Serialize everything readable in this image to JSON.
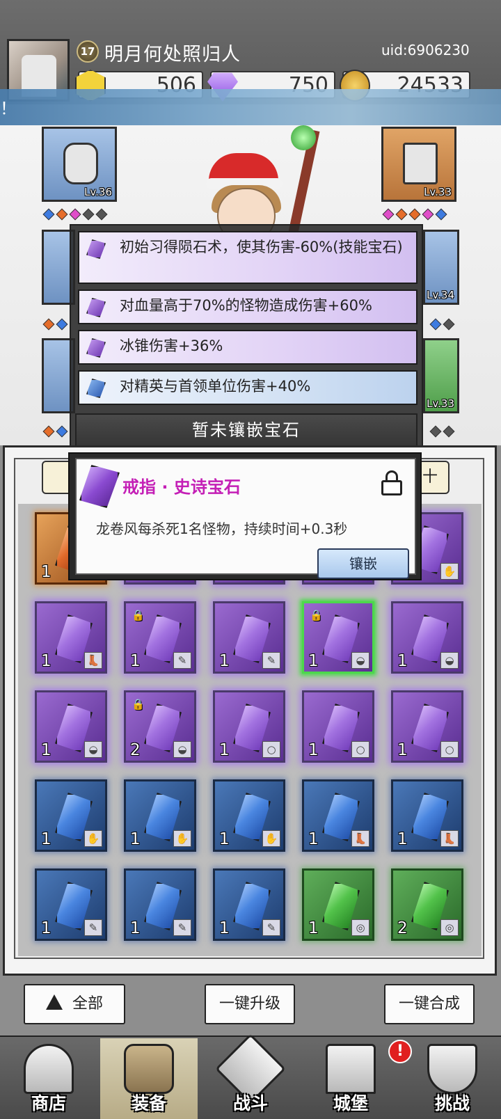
{
  "header": {
    "level": "17",
    "player_name": "明月何处照归人",
    "uid": "uid:6906230",
    "banner_fragment": "！",
    "currencies": [
      {
        "name": "gold-hex",
        "value": "506",
        "color": "#f3d33b"
      },
      {
        "name": "diamond",
        "value": "750",
        "color": "#a86ef0"
      },
      {
        "name": "coin",
        "value": "24533",
        "color": "#e0a832"
      }
    ]
  },
  "equipment": {
    "left_top_level": "Lv.36",
    "right_top_level": "Lv.33",
    "right_mid_level": "Lv.34",
    "right_bottom_level": "Lv.33"
  },
  "affixes": [
    {
      "text": "初始习得陨石术，使其伤害-60%(技能宝石)",
      "gem_color": "purple"
    },
    {
      "text": "对血量高于70%的怪物造成伤害+60%",
      "gem_color": "purple"
    },
    {
      "text": "冰锥伤害+36%",
      "gem_color": "purple"
    },
    {
      "text": "对精英与首领单位伤害+40%",
      "gem_color": "blue"
    }
  ],
  "no_gem_text": "暂未镶嵌宝石",
  "gem_popup": {
    "title": "戒指 · 史诗宝石",
    "description": "龙卷风每杀死1名怪物，持续时间+0.3秒",
    "inlay_label": "镶嵌",
    "locked": true
  },
  "filter_tab_fragment": "十",
  "inventory": {
    "rows": [
      [
        {
          "color": "orange",
          "qty": "1",
          "locked": false,
          "type": ""
        },
        {
          "color": "purple",
          "qty": "",
          "locked": false,
          "type": ""
        },
        {
          "color": "purple",
          "qty": "",
          "locked": false,
          "type": ""
        },
        {
          "color": "purple",
          "qty": "",
          "locked": false,
          "type": ""
        },
        {
          "color": "purple",
          "qty": "",
          "locked": false,
          "type": "✋"
        }
      ],
      [
        {
          "color": "purple",
          "qty": "1",
          "locked": false,
          "type": "👢"
        },
        {
          "color": "purple",
          "qty": "1",
          "locked": true,
          "type": "✎"
        },
        {
          "color": "purple",
          "qty": "1",
          "locked": false,
          "type": "✎"
        },
        {
          "color": "purple",
          "qty": "1",
          "locked": true,
          "type": "◒",
          "selected": true
        },
        {
          "color": "purple",
          "qty": "1",
          "locked": false,
          "type": "◒"
        }
      ],
      [
        {
          "color": "purple",
          "qty": "1",
          "locked": false,
          "type": "◒"
        },
        {
          "color": "purple",
          "qty": "2",
          "locked": true,
          "type": "◒"
        },
        {
          "color": "purple",
          "qty": "1",
          "locked": false,
          "type": "○"
        },
        {
          "color": "purple",
          "qty": "1",
          "locked": false,
          "type": "○"
        },
        {
          "color": "purple",
          "qty": "1",
          "locked": false,
          "type": "○"
        }
      ],
      [
        {
          "color": "blue",
          "qty": "1",
          "locked": false,
          "type": "✋"
        },
        {
          "color": "blue",
          "qty": "1",
          "locked": false,
          "type": "✋"
        },
        {
          "color": "blue",
          "qty": "1",
          "locked": false,
          "type": "✋"
        },
        {
          "color": "blue",
          "qty": "1",
          "locked": false,
          "type": "👢"
        },
        {
          "color": "blue",
          "qty": "1",
          "locked": false,
          "type": "👢"
        }
      ],
      [
        {
          "color": "blue",
          "qty": "1",
          "locked": false,
          "type": "✎"
        },
        {
          "color": "blue",
          "qty": "1",
          "locked": false,
          "type": "✎"
        },
        {
          "color": "blue",
          "qty": "1",
          "locked": false,
          "type": "✎"
        },
        {
          "color": "green",
          "qty": "1",
          "locked": false,
          "type": "◎"
        },
        {
          "color": "green",
          "qty": "2",
          "locked": false,
          "type": "◎"
        }
      ]
    ]
  },
  "actions": {
    "all_label": "全部",
    "upgrade_label": "一键升级",
    "compose_label": "一键合成"
  },
  "nav": {
    "items": [
      {
        "label": "商店",
        "icon": "shop-icon"
      },
      {
        "label": "装备",
        "icon": "backpack-icon",
        "active": true
      },
      {
        "label": "战斗",
        "icon": "crossed-swords-icon"
      },
      {
        "label": "城堡",
        "icon": "castle-icon"
      },
      {
        "label": "挑战",
        "icon": "shield-icon"
      }
    ],
    "badge": "!"
  }
}
